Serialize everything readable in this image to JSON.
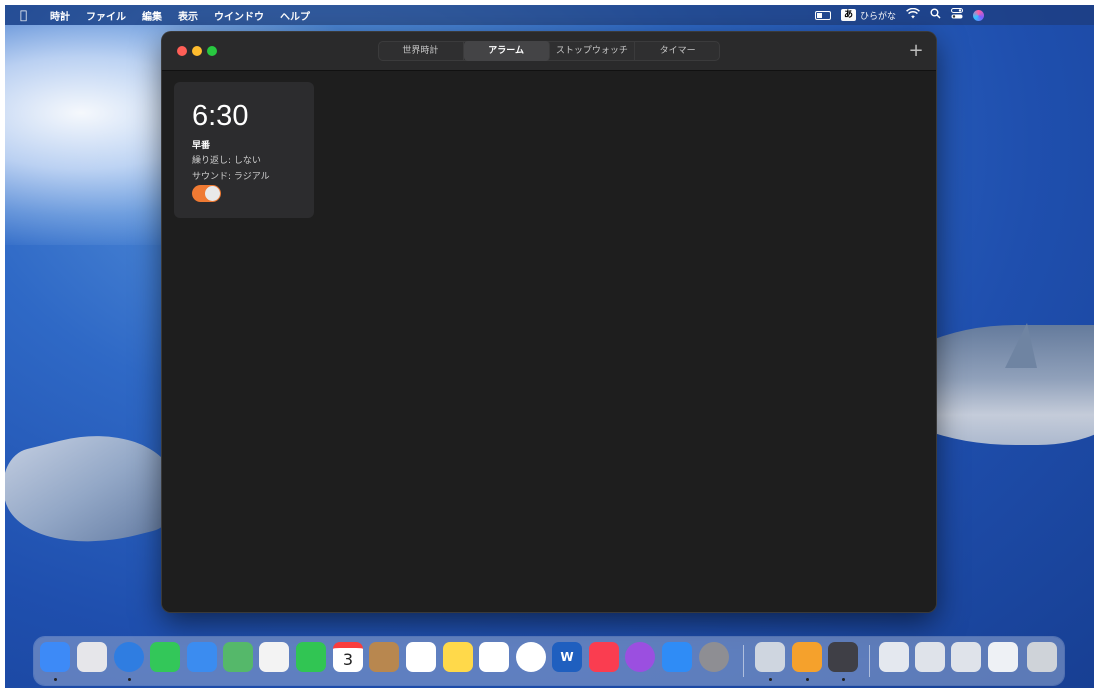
{
  "menubar": {
    "app_name": "時計",
    "menus": [
      "ファイル",
      "編集",
      "表示",
      "ウインドウ",
      "ヘルプ"
    ],
    "ime_box": "あ",
    "ime_label": "ひらがな"
  },
  "window": {
    "tabs": [
      {
        "label": "世界時計",
        "active": false
      },
      {
        "label": "アラーム",
        "active": true
      },
      {
        "label": "ストップウォッチ",
        "active": false
      },
      {
        "label": "タイマー",
        "active": false
      }
    ],
    "add_label": "+"
  },
  "alarm": {
    "time": "6:30",
    "label": "早番",
    "repeat": "繰り返し: しない",
    "sound": "サウンド: ラジアル",
    "enabled": true,
    "toggle_color": "#ef7a33"
  },
  "dock": {
    "calendar_day": "3",
    "word_letter": "W",
    "apps": [
      {
        "name": "finder",
        "color": "#3d8af7"
      },
      {
        "name": "launchpad",
        "color": "#e6e6ea"
      },
      {
        "name": "safari",
        "color": "#2f7de1"
      },
      {
        "name": "messages",
        "color": "#33c759"
      },
      {
        "name": "mail",
        "color": "#3b8cf0"
      },
      {
        "name": "maps",
        "color": "#55b86a"
      },
      {
        "name": "photos",
        "color": "#f3f3f3"
      },
      {
        "name": "facetime",
        "color": "#31c553"
      },
      {
        "name": "calendar",
        "color": "#ffffff"
      },
      {
        "name": "contacts",
        "color": "#b8874f"
      },
      {
        "name": "reminders",
        "color": "#ffffff"
      },
      {
        "name": "notes",
        "color": "#ffd94a"
      },
      {
        "name": "freeform",
        "color": "#ffffff"
      },
      {
        "name": "chrome",
        "color": "#ffffff"
      },
      {
        "name": "word",
        "color": "#1f5fbf"
      },
      {
        "name": "music",
        "color": "#fa3d50"
      },
      {
        "name": "podcasts",
        "color": "#9b4fe0"
      },
      {
        "name": "app-store",
        "color": "#2f8cf6"
      },
      {
        "name": "system-settings",
        "color": "#8e8e93"
      },
      {
        "name": "preview",
        "color": "#cfd6e0"
      },
      {
        "name": "pages",
        "color": "#f5a12c"
      },
      {
        "name": "shortcuts",
        "color": "#3f3f46"
      },
      {
        "name": "downloads-stack",
        "color": "#e4e8ef"
      },
      {
        "name": "screenshot-stack",
        "color": "#dfe3ea"
      },
      {
        "name": "file-stack",
        "color": "#dfe3ea"
      },
      {
        "name": "document-stack",
        "color": "#eef1f5"
      },
      {
        "name": "trash",
        "color": "#cfd3d9"
      }
    ]
  }
}
